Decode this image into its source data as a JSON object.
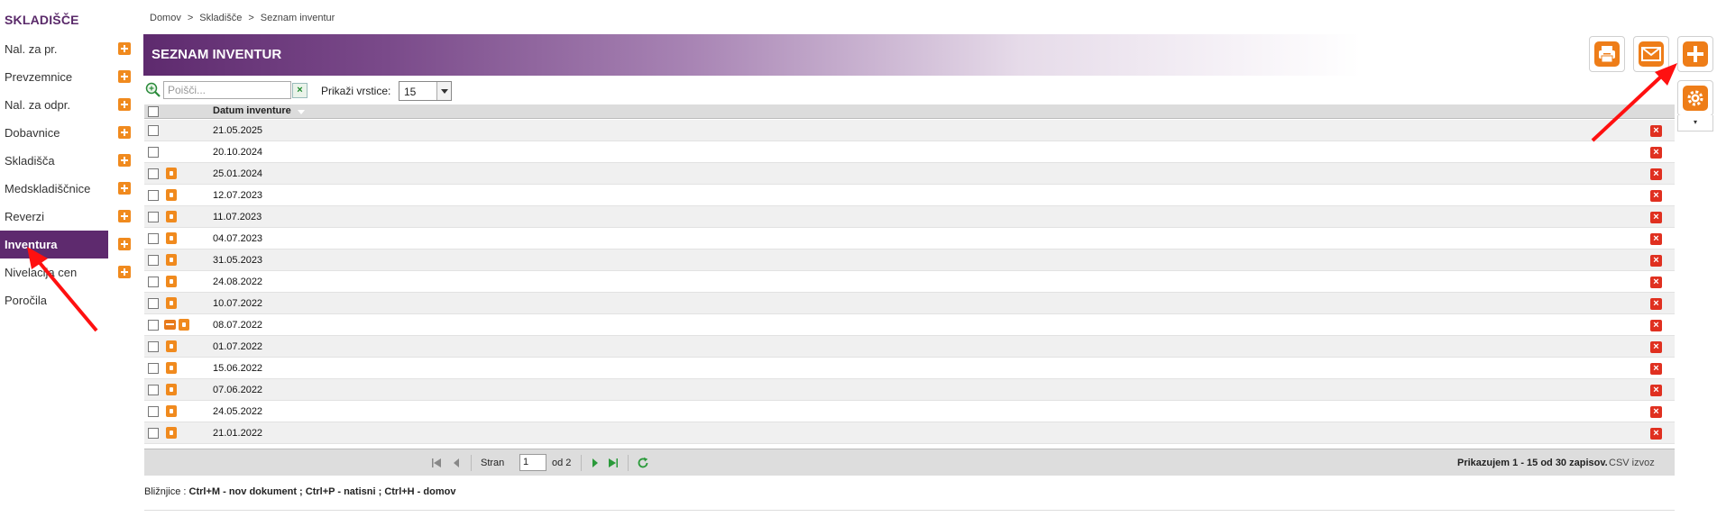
{
  "sidebar": {
    "title": "SKLADIŠČE",
    "items": [
      {
        "label": "Nal. za pr.",
        "has_add": true,
        "active": false
      },
      {
        "label": "Prevzemnice",
        "has_add": true,
        "active": false
      },
      {
        "label": "Nal. za odpr.",
        "has_add": true,
        "active": false
      },
      {
        "label": "Dobavnice",
        "has_add": true,
        "active": false
      },
      {
        "label": "Skladišča",
        "has_add": true,
        "active": false
      },
      {
        "label": "Medskladiščnice",
        "has_add": true,
        "active": false
      },
      {
        "label": "Reverzi",
        "has_add": true,
        "active": false
      },
      {
        "label": "Inventura",
        "has_add": true,
        "active": true
      },
      {
        "label": "Nivelacija cen",
        "has_add": true,
        "active": false
      },
      {
        "label": "Poročila",
        "has_add": false,
        "active": false
      }
    ]
  },
  "breadcrumb": {
    "items": [
      "Domov",
      "Skladišče",
      "Seznam inventur"
    ],
    "separator": ">"
  },
  "header": {
    "title": "SEZNAM INVENTUR"
  },
  "toolbar": {
    "print_icon": "printer-icon",
    "email_icon": "envelope-icon",
    "add_icon": "plus-icon",
    "settings_icon": "gear-icon",
    "dropdown_caret": "▾"
  },
  "search": {
    "placeholder": "Poišči...",
    "value": "",
    "clear_label": "×",
    "rows_label": "Prikaži vrstice:",
    "rows_value": "15"
  },
  "table": {
    "column_header": "Datum inventure",
    "rows": [
      {
        "date": "21.05.2025",
        "locked": false,
        "printed": false
      },
      {
        "date": "20.10.2024",
        "locked": false,
        "printed": false
      },
      {
        "date": "25.01.2024",
        "locked": true,
        "printed": false
      },
      {
        "date": "12.07.2023",
        "locked": true,
        "printed": false
      },
      {
        "date": "11.07.2023",
        "locked": true,
        "printed": false
      },
      {
        "date": "04.07.2023",
        "locked": true,
        "printed": false
      },
      {
        "date": "31.05.2023",
        "locked": true,
        "printed": false
      },
      {
        "date": "24.08.2022",
        "locked": true,
        "printed": false
      },
      {
        "date": "10.07.2022",
        "locked": true,
        "printed": false
      },
      {
        "date": "08.07.2022",
        "locked": true,
        "printed": true
      },
      {
        "date": "01.07.2022",
        "locked": true,
        "printed": false
      },
      {
        "date": "15.06.2022",
        "locked": true,
        "printed": false
      },
      {
        "date": "07.06.2022",
        "locked": true,
        "printed": false
      },
      {
        "date": "24.05.2022",
        "locked": true,
        "printed": false
      },
      {
        "date": "21.01.2022",
        "locked": true,
        "printed": false
      }
    ],
    "delete_label": "×"
  },
  "pager": {
    "page_label": "Stran",
    "page_value": "1",
    "of_label": "od 2",
    "info": "Prikazujem 1 - 15 od 30 zapisov.",
    "csv": "CSV izvoz"
  },
  "shortcuts": {
    "prefix": "Bližnjice :",
    "s1": "Ctrl+M - nov dokument ;",
    "s2": "Ctrl+P - natisni ;",
    "s3": "Ctrl+H - domov"
  },
  "colors": {
    "brand_purple": "#5e2a6e",
    "accent_orange": "#f08a1e",
    "delete_red": "#e03020",
    "annotation_red": "#ff1010"
  }
}
